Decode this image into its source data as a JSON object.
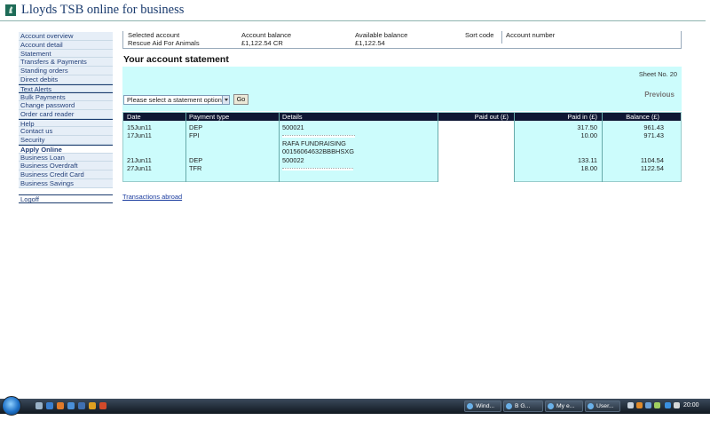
{
  "header": {
    "brand": "Lloyds TSB online for business"
  },
  "sidebar": {
    "items": [
      {
        "label": "Account overview"
      },
      {
        "label": "Account detail"
      },
      {
        "label": "Statement"
      },
      {
        "label": "Transfers & Payments"
      },
      {
        "label": "Standing orders"
      },
      {
        "label": "Direct debits"
      },
      {
        "label": "Text Alerts"
      },
      {
        "label": "Bulk Payments"
      },
      {
        "label": "Change password"
      },
      {
        "label": "Order card reader"
      },
      {
        "label": "Help"
      },
      {
        "label": "Contact us"
      },
      {
        "label": "Security"
      },
      {
        "label": "Apply Online"
      },
      {
        "label": "Business Loan"
      },
      {
        "label": "Business Overdraft"
      },
      {
        "label": "Business Credit Card"
      },
      {
        "label": "Business Savings"
      }
    ],
    "logoff": "Logoff"
  },
  "summary": {
    "selected_account_label": "Selected account",
    "selected_account_value": "Rescue Aid For Animals",
    "account_balance_label": "Account balance",
    "account_balance_value": "£1,122.54 CR",
    "available_balance_label": "Available balance",
    "available_balance_value": "£1,122.54",
    "sort_code_label": "Sort code",
    "account_number_label": "Account number"
  },
  "page": {
    "title": "Your account statement"
  },
  "statement": {
    "sheet_no": "Sheet No. 20",
    "previous": "Previous",
    "select_placeholder": "Please select a statement option",
    "go": "Go"
  },
  "table": {
    "headers": {
      "date": "Date",
      "payment_type": "Payment type",
      "details": "Details",
      "paid_out": "Paid out (£)",
      "paid_in": "Paid in (£)",
      "balance": "Balance (£)"
    },
    "rows": [
      {
        "date": "15Jun11",
        "type": "DEP",
        "details": [
          "500021"
        ],
        "paid_out": "",
        "paid_in": "317.50",
        "balance": "961.43"
      },
      {
        "date": "17Jun11",
        "type": "FPI",
        "details": [
          "RAFA FUNDRAISING",
          "00156064632BBBHSXG"
        ],
        "paid_out": "",
        "paid_in": "10.00",
        "balance": "971.43"
      },
      {
        "date": "21Jun11",
        "type": "DEP",
        "details": [
          "500022"
        ],
        "paid_out": "",
        "paid_in": "133.11",
        "balance": "1104.54"
      },
      {
        "date": "27Jun11",
        "type": "TFR",
        "details": [],
        "paid_out": "",
        "paid_in": "18.00",
        "balance": "1122.54"
      }
    ]
  },
  "links": {
    "transactions_abroad": "Transactions abroad"
  },
  "taskbar": {
    "buttons": [
      {
        "label": "Wind..."
      },
      {
        "label": "B G..."
      },
      {
        "label": "My e..."
      },
      {
        "label": "User..."
      }
    ],
    "clock": "20:00"
  },
  "colors": {
    "brand_navy": "#1a3b6e",
    "statement_bg": "#ccfcfc",
    "table_header_bg": "#0f1633"
  }
}
